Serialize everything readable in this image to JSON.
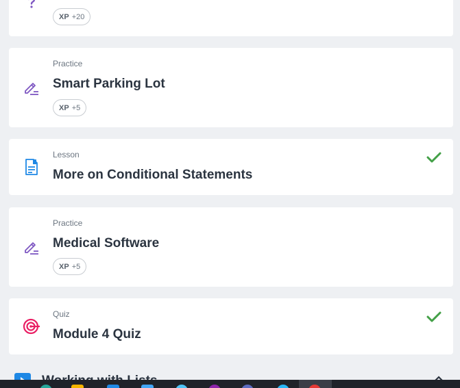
{
  "items": [
    {
      "type": "",
      "title": "",
      "xp_label": "XP",
      "xp_value": "+20",
      "completed": false,
      "icon": "question-icon",
      "icon_color": "#7e57c2"
    },
    {
      "type": "Practice",
      "title": "Smart Parking Lot",
      "xp_label": "XP",
      "xp_value": "+5",
      "completed": false,
      "icon": "pencil-icon",
      "icon_color": "#7e57c2"
    },
    {
      "type": "Lesson",
      "title": "More on Conditional Statements",
      "completed": true,
      "icon": "document-icon",
      "icon_color": "#1e88e5"
    },
    {
      "type": "Practice",
      "title": "Medical Software",
      "xp_label": "XP",
      "xp_value": "+5",
      "completed": false,
      "icon": "pencil-icon",
      "icon_color": "#7e57c2"
    },
    {
      "type": "Quiz",
      "title": "Module 4 Quiz",
      "completed": true,
      "icon": "target-icon",
      "icon_color": "#e91e63"
    }
  ],
  "next_section": {
    "title": "Working with Lists",
    "icon": "play-icon"
  },
  "colors": {
    "check": "#43a047",
    "background": "#eef0f3",
    "taskbar": "#1f2229"
  },
  "taskbar": {
    "icons": [
      "app-icon-1",
      "app-icon-2",
      "app-icon-3",
      "app-icon-4",
      "app-icon-5",
      "app-icon-6",
      "app-icon-7",
      "app-icon-8",
      "app-icon-9"
    ]
  }
}
